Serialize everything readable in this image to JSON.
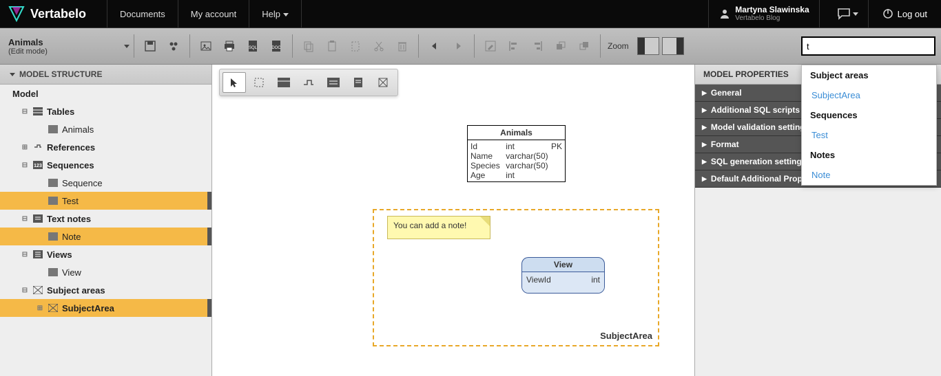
{
  "header": {
    "brand": "Vertabelo",
    "nav": {
      "documents": "Documents",
      "account": "My account",
      "help": "Help"
    },
    "user": {
      "name": "Martyna Slawinska",
      "sub": "Vertabelo Blog"
    },
    "logout": "Log out"
  },
  "toolbar": {
    "model_name": "Animals",
    "mode": "(Edit mode)",
    "zoom": "Zoom",
    "search_value": "t"
  },
  "left": {
    "header": "MODEL STRUCTURE",
    "root": "Model",
    "tables": "Tables",
    "animals": "Animals",
    "references": "References",
    "sequences": "Sequences",
    "sequence": "Sequence",
    "test": "Test",
    "textnotes": "Text notes",
    "note": "Note",
    "views": "Views",
    "view": "View",
    "subjectareas": "Subject areas",
    "subjectarea": "SubjectArea"
  },
  "canvas": {
    "table_name": "Animals",
    "cols": {
      "id": "Id",
      "id_t": "int",
      "id_pk": "PK",
      "name": "Name",
      "name_t": "varchar(50)",
      "species": "Species",
      "species_t": "varchar(50)",
      "age": "Age",
      "age_t": "int"
    },
    "note_text": "You can add a note!",
    "view_name": "View",
    "view_col": "ViewId",
    "view_col_t": "int",
    "subject_label": "SubjectArea"
  },
  "right": {
    "header": "MODEL PROPERTIES",
    "sections": {
      "general": "General",
      "sql": "Additional SQL scripts",
      "validation": "Model validation settings",
      "format": "Format",
      "sqlgen": "SQL generation settings",
      "default": "Default Additional Properties"
    }
  },
  "dropdown": {
    "g1": "Subject areas",
    "i1": "SubjectArea",
    "g2": "Sequences",
    "i2": "Test",
    "g3": "Notes",
    "i3": "Note"
  }
}
